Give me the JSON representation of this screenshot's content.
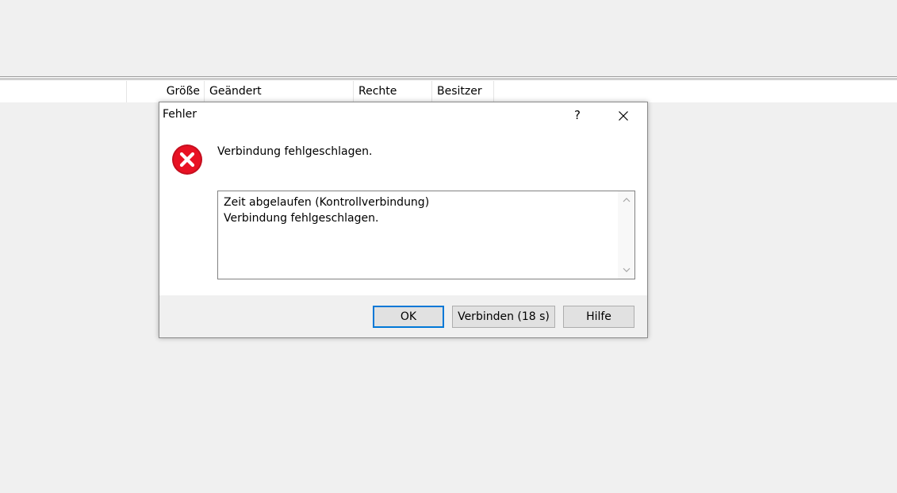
{
  "columns": {
    "size": "Größe",
    "modified": "Geändert",
    "permissions": "Rechte",
    "owner": "Besitzer"
  },
  "dialog": {
    "title": "Fehler",
    "help_symbol": "?",
    "message": "Verbindung fehlgeschlagen.",
    "details": [
      "Zeit abgelaufen (Kontrollverbindung)",
      "Verbindung fehlgeschlagen."
    ],
    "buttons": {
      "ok": "OK",
      "reconnect": "Verbinden (18 s)",
      "help": "Hilfe"
    },
    "icons": {
      "error": "error-icon",
      "close": "close-icon",
      "scroll_up": "chevron-up-icon",
      "scroll_down": "chevron-down-icon"
    },
    "colors": {
      "error_red": "#e81123",
      "accent": "#0078d7"
    }
  }
}
